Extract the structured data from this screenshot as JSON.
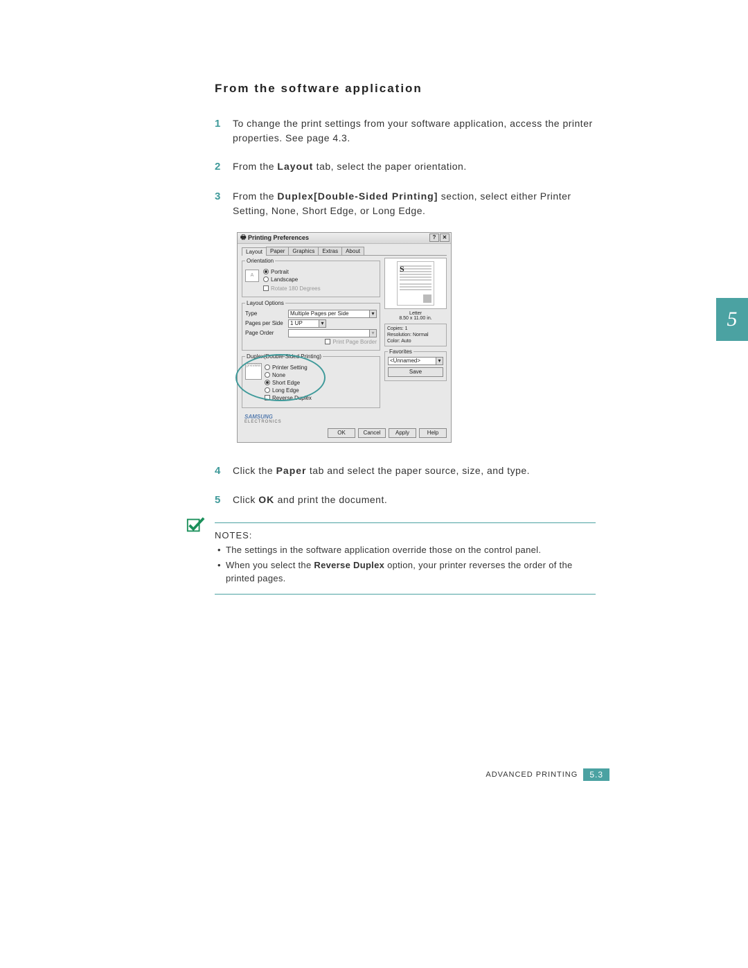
{
  "heading": "From the software application",
  "chapter_tab": "5",
  "steps": {
    "s1": {
      "num": "1",
      "text_a": "To change the print settings from your software application, access the printer properties. See page 4.3."
    },
    "s2": {
      "num": "2",
      "text_a": "From the ",
      "bold": "Layout",
      "text_b": " tab, select the paper orientation."
    },
    "s3": {
      "num": "3",
      "text_a": "From the ",
      "bold": "Duplex[Double-Sided Printing]",
      "text_b": " section, select either Printer Setting, None, Short Edge, or Long Edge."
    },
    "s4": {
      "num": "4",
      "text_a": "Click the ",
      "bold": "Paper",
      "text_b": " tab and select the paper source, size, and type."
    },
    "s5": {
      "num": "5",
      "text_a": "Click ",
      "bold": "OK",
      "text_b": " and print the document."
    }
  },
  "dialog": {
    "title": "Printing Preferences",
    "help_btn": "?",
    "close_btn": "✕",
    "tabs": [
      "Layout",
      "Paper",
      "Graphics",
      "Extras",
      "About"
    ],
    "orientation": {
      "legend": "Orientation",
      "portrait": "Portrait",
      "landscape": "Landscape",
      "rotate": "Rotate 180 Degrees"
    },
    "layout_options": {
      "legend": "Layout Options",
      "type_label": "Type",
      "type_value": "Multiple Pages per Side",
      "pps_label": "Pages per Side",
      "pps_value": "1 UP",
      "order_label": "Page Order",
      "border": "Print Page Border"
    },
    "duplex": {
      "legend": "Duplex(Double-Sided Printing)",
      "icon_caption": "preview",
      "opts": [
        "Printer Setting",
        "None",
        "Short Edge",
        "Long Edge"
      ],
      "reverse": "Reverse Duplex"
    },
    "brand": "SAMSUNG",
    "brand_sub": "ELECTRONICS",
    "preview": {
      "letter": "S",
      "paper_label": "Letter",
      "paper_dim": "8.50 x 11.00 in."
    },
    "info": {
      "copies": "Copies: 1",
      "res": "Resolution: Normal",
      "color": "Color: Auto"
    },
    "favorites": {
      "legend": "Favorites",
      "value": "<Unnamed>",
      "save": "Save"
    },
    "buttons": {
      "ok": "OK",
      "cancel": "Cancel",
      "apply": "Apply",
      "help": "Help"
    }
  },
  "notes": {
    "label": "NOTES:",
    "items": {
      "n1a": "The settings in the software application override those on the control panel.",
      "n2a": "When you select the ",
      "n2b": "Reverse Duplex",
      "n2c": " option, your printer reverses the order of the printed pages."
    }
  },
  "footer": {
    "label": "ADVANCED PRINTING",
    "badge": "5.3"
  }
}
